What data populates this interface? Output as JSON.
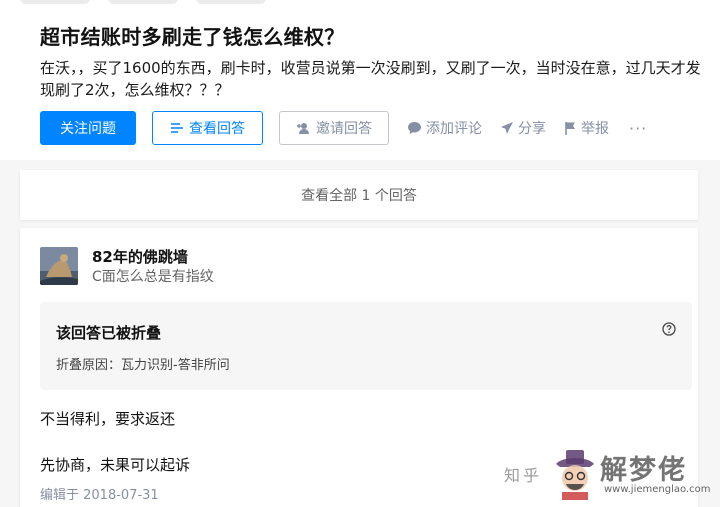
{
  "question": {
    "title": "超市结账时多刷走了钱怎么维权？",
    "body": "在沃，，买了1600的东西，刷卡时，收营员说第一次没刷到，又刷了一次，当时没在意，过几天才发现刷了2次，怎么维权？？？"
  },
  "actions": {
    "follow_label": "关注问题",
    "view_answers_label": "查看回答",
    "invite_label": "邀请回答",
    "comment_label": "添加评论",
    "share_label": "分享",
    "report_label": "举报",
    "more_label": "···"
  },
  "view_all_label": "查看全部 1 个回答",
  "answer": {
    "author_name": "82年的佛跳墙",
    "author_bio": "C面怎么总是有指纹",
    "collapsed_title": "该回答已被折叠",
    "collapsed_reason": "折叠原因：瓦力识别-答非所问",
    "paragraph1": "不当得利，要求返还",
    "paragraph2": "先协商，未果可以起诉",
    "edited": "编辑于 2018-07-31"
  },
  "watermark": {
    "zhihu": "知乎",
    "brand": "解梦佬",
    "url": "www.jiemenglao.com"
  },
  "colors": {
    "accent": "#0084ff",
    "muted": "#8590a6"
  }
}
